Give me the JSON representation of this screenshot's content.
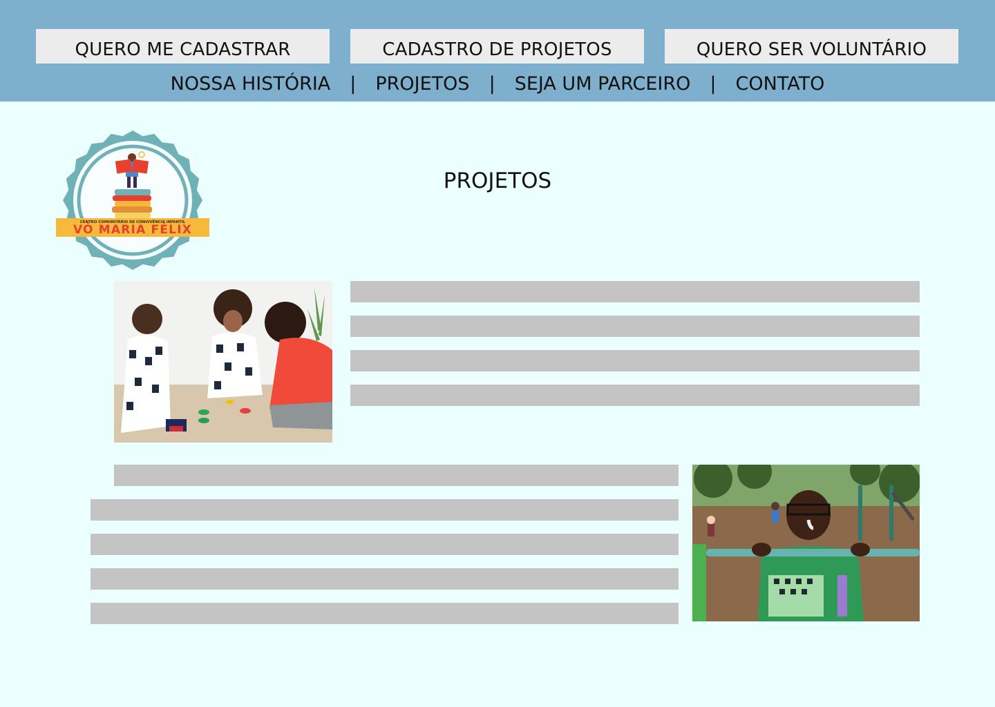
{
  "header": {
    "buttons": [
      {
        "label": "QUERO ME CADASTRAR"
      },
      {
        "label": "CADASTRO DE PROJETOS"
      },
      {
        "label": "QUERO SER VOLUNTÁRIO"
      }
    ],
    "nav": [
      {
        "label": "NOSSA HISTÓRIA"
      },
      {
        "label": "PROJETOS"
      },
      {
        "label": "SEJA UM PARCEIRO"
      },
      {
        "label": "CONTATO"
      }
    ],
    "separator": "|"
  },
  "logo": {
    "tagline": "CENTRO COMUNITÁRIO DE CONVIVÊNCIA INFANTIL",
    "name": "VÓ MARIA FÉLIX"
  },
  "main": {
    "title": "PROJETOS"
  },
  "colors": {
    "header_bg": "#7eafcd",
    "page_bg": "#ebffff",
    "button_bg": "#ececec",
    "placeholder_bar": "#c4c4c4",
    "logo_teal": "#6fb1b6",
    "logo_yellow": "#f6b93b",
    "logo_red": "#e8402f"
  }
}
